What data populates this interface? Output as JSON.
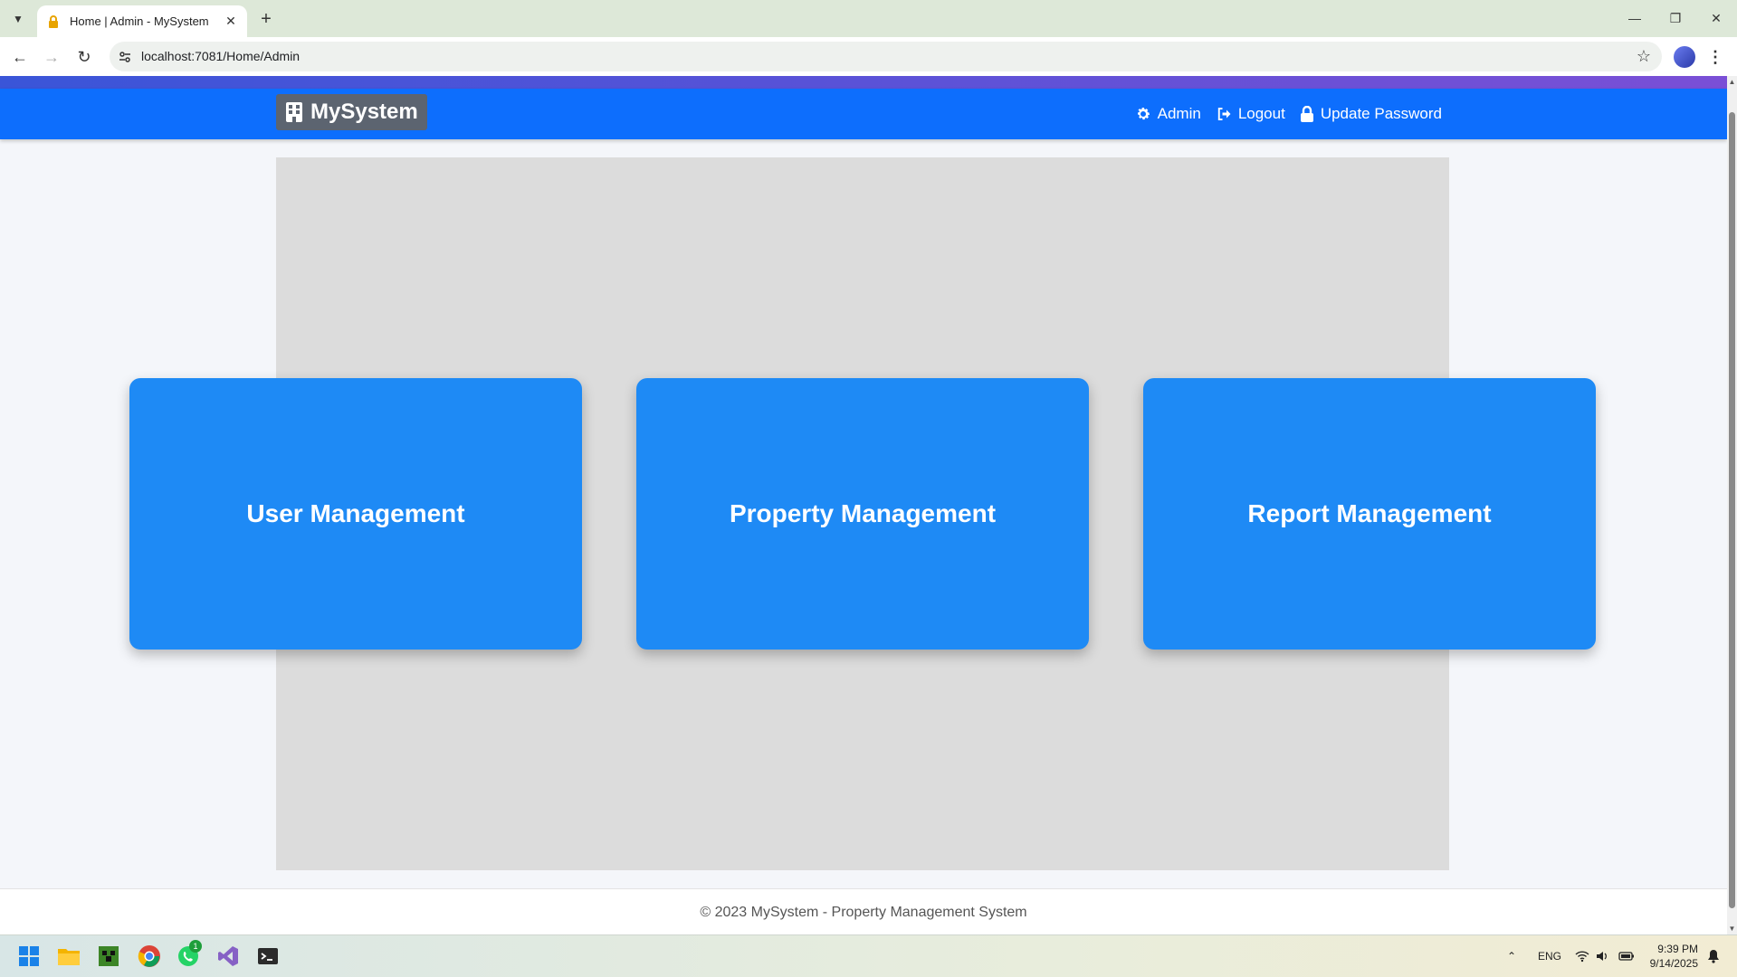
{
  "browser": {
    "tab_title": "Home | Admin - MySystem",
    "url": "localhost:7081/Home/Admin"
  },
  "navbar": {
    "brand": "MySystem",
    "links": [
      {
        "label": "Admin",
        "icon": "gear-icon"
      },
      {
        "label": "Logout",
        "icon": "logout-icon"
      },
      {
        "label": "Update Password",
        "icon": "lock-icon"
      }
    ]
  },
  "cards": [
    {
      "label": "User Management"
    },
    {
      "label": "Property Management"
    },
    {
      "label": "Report Management"
    }
  ],
  "footer": {
    "text": "© 2023 MySystem - Property Management System"
  },
  "taskbar": {
    "language": "ENG",
    "time": "9:39 PM",
    "date": "9/14/2025",
    "whatsapp_badge": "1"
  },
  "colors": {
    "navbar": "#0d6efd",
    "card": "#1e8af5",
    "hero_bg": "#dcdcdc"
  }
}
